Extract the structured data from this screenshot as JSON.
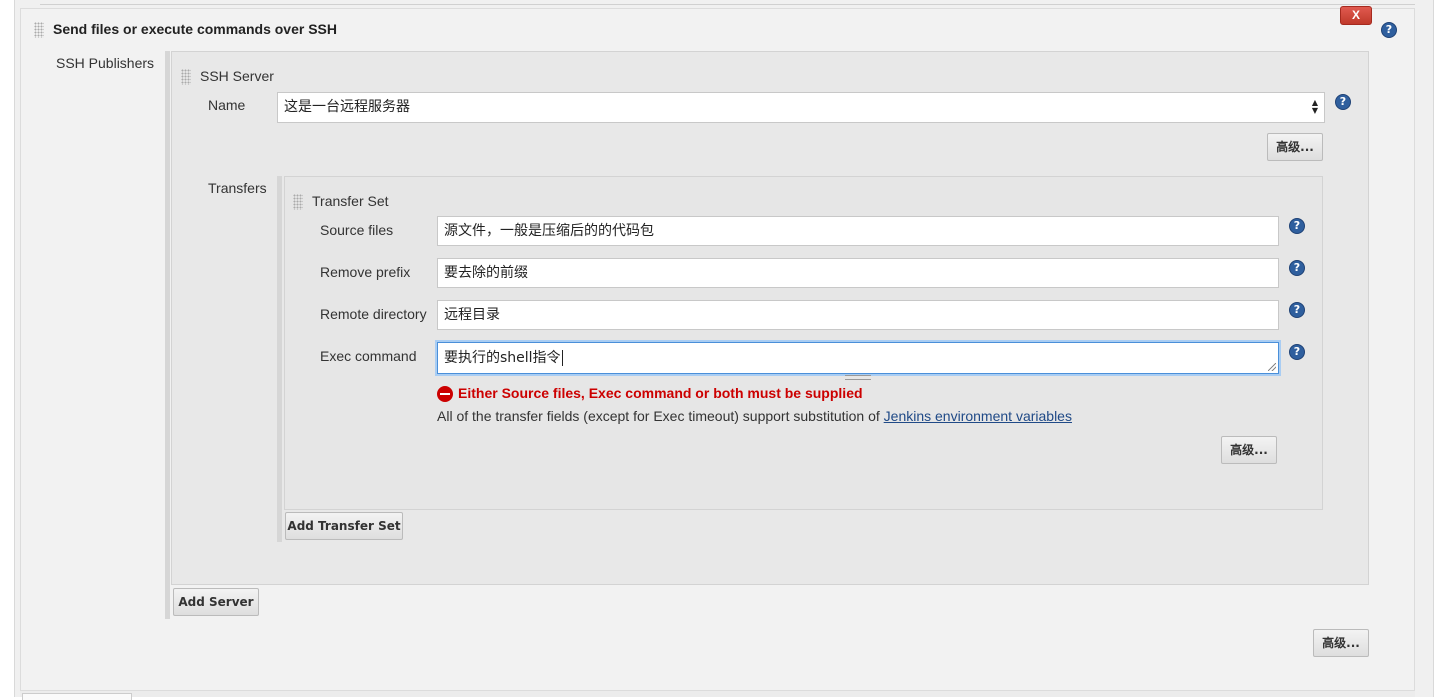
{
  "section": {
    "title": "Send files or execute commands over SSH",
    "close_label": "X",
    "help_icon": "?"
  },
  "publishers": {
    "label": "SSH Publishers",
    "server": {
      "title": "SSH Server",
      "name_label": "Name",
      "name_value": "这是一台远程服务器",
      "advanced_label": "高级...",
      "transfers_label": "Transfers",
      "transfer_set": {
        "title": "Transfer Set",
        "source_files_label": "Source files",
        "source_files_value": "源文件，一般是压缩后的的代码包",
        "remove_prefix_label": "Remove prefix",
        "remove_prefix_value": "要去除的前缀",
        "remote_directory_label": "Remote directory",
        "remote_directory_value": "远程目录",
        "exec_command_label": "Exec command",
        "exec_command_value": "要执行的shell指令",
        "error_message": "Either Source files, Exec command or both must be supplied",
        "note_text": "All of the transfer fields (except for Exec timeout) support substitution of ",
        "note_link": "Jenkins environment variables",
        "advanced_label": "高级..."
      },
      "add_transfer_set_label": "Add Transfer Set"
    },
    "add_server_label": "Add Server"
  },
  "section_advanced_label": "高级...",
  "colors": {
    "error": "#cc0000",
    "help_icon": "#2f5f9e",
    "close_button": "#c0392b",
    "focus_ring": "#4a8fd9",
    "link": "#204a87"
  }
}
